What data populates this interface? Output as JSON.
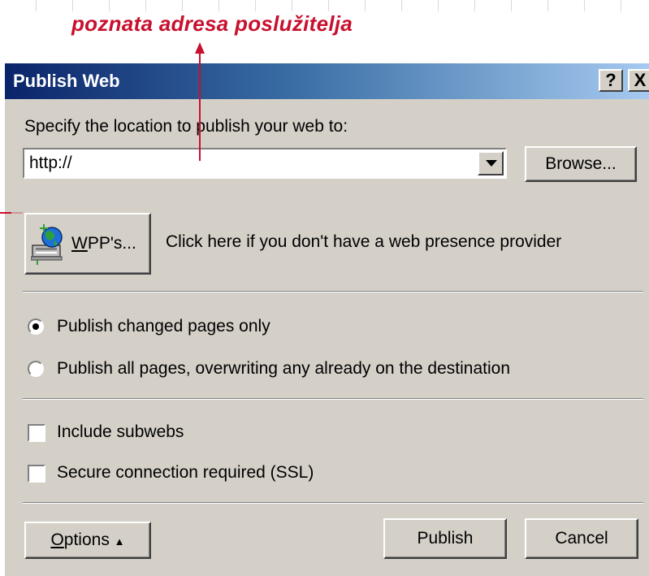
{
  "annotation": {
    "text": "poznata adresa poslužitelja",
    "color": "#c8102e"
  },
  "dialog": {
    "title": "Publish Web",
    "title_buttons": {
      "help": "?",
      "close": "X"
    },
    "location_label": "Specify the location to publish your web to:",
    "url_value": "http://",
    "browse_label": "Browse...",
    "wpp": {
      "button_label": "WPP's...",
      "button_access_key": "W",
      "button_label_rest": "PP's...",
      "description": "Click here if you don't have a web presence provider",
      "icon": "globe-computer-icon"
    },
    "radios": [
      {
        "label": "Publish changed pages only",
        "checked": true
      },
      {
        "label": "Publish all pages, overwriting any already on the destination",
        "checked": false
      }
    ],
    "checkboxes": [
      {
        "label": "Include subwebs",
        "checked": false
      },
      {
        "label": "Secure connection required (SSL)",
        "checked": false
      }
    ],
    "options": {
      "access_key": "O",
      "rest": "ptions",
      "arrow": "▲"
    },
    "publish_label": "Publish",
    "cancel_label": "Cancel"
  },
  "colors": {
    "title_gradient_start": "#0a246a",
    "title_gradient_end": "#a6caf0",
    "dialog_face": "#d4d0c8",
    "annotation_arrow": "#c8102e"
  }
}
